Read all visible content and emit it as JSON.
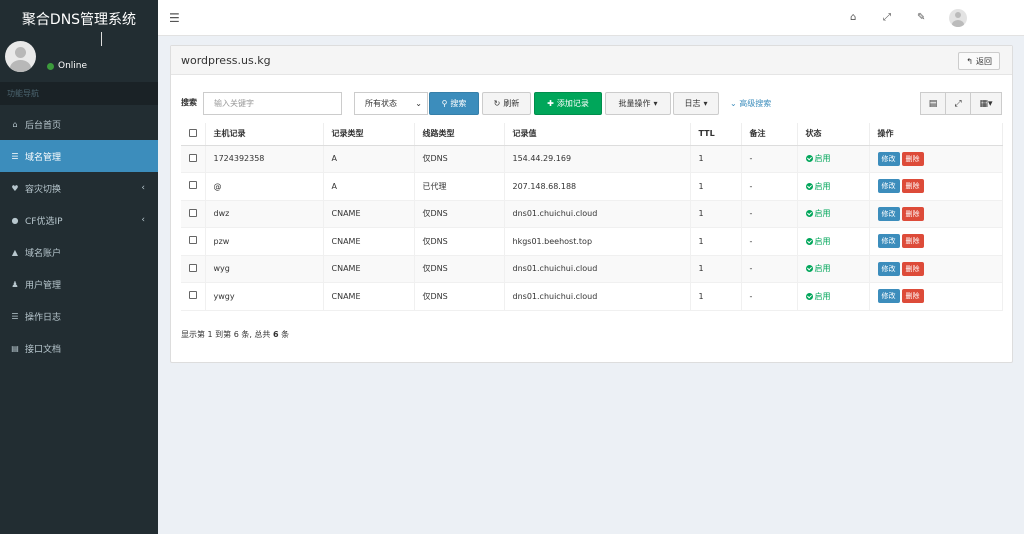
{
  "app": {
    "title": "聚合DNS管理系统"
  },
  "user": {
    "status": "Online"
  },
  "nav": {
    "header": "功能导航",
    "items": [
      {
        "label": "后台首页",
        "icon": "home-icon",
        "glyph": "⌂",
        "active": false,
        "caret": ""
      },
      {
        "label": "域名管理",
        "icon": "list-icon",
        "glyph": "☰",
        "active": true,
        "caret": ""
      },
      {
        "label": "容灾切换",
        "icon": "heartbeat-icon",
        "glyph": "♥",
        "active": false,
        "caret": "‹"
      },
      {
        "label": "CF优选IP",
        "icon": "globe-icon",
        "glyph": "●",
        "active": false,
        "caret": "‹"
      },
      {
        "label": "域名账户",
        "icon": "lock-icon",
        "glyph": "▲",
        "active": false,
        "caret": ""
      },
      {
        "label": "用户管理",
        "icon": "user-icon",
        "glyph": "♟",
        "active": false,
        "caret": ""
      },
      {
        "label": "操作日志",
        "icon": "log-icon",
        "glyph": "☰",
        "active": false,
        "caret": ""
      },
      {
        "label": "接口文档",
        "icon": "book-icon",
        "glyph": "▤",
        "active": false,
        "caret": ""
      }
    ]
  },
  "topbar": {
    "icons": [
      "home-icon",
      "fullscreen-icon",
      "wrench-icon"
    ]
  },
  "panel": {
    "title": "wordpress.us.kg",
    "back_label": "返回"
  },
  "toolbar": {
    "search_label": "搜索",
    "search_placeholder": "输入关键字",
    "status_select": "所有状态",
    "search_btn": "搜索",
    "refresh_btn": "刷新",
    "add_btn": "添加记录",
    "batch_btn": "批量操作",
    "log_btn": "日志",
    "advanced_link": "高级搜索"
  },
  "table": {
    "headers": [
      "主机记录",
      "记录类型",
      "线路类型",
      "记录值",
      "TTL",
      "备注",
      "状态",
      "操作"
    ],
    "rows": [
      {
        "host": "1724392358",
        "type": "A",
        "line": "仅DNS",
        "value": "154.44.29.169",
        "ttl": "1",
        "note": "-",
        "status": "启用"
      },
      {
        "host": "@",
        "type": "A",
        "line": "已代理",
        "value": "207.148.68.188",
        "ttl": "1",
        "note": "-",
        "status": "启用"
      },
      {
        "host": "dwz",
        "type": "CNAME",
        "line": "仅DNS",
        "value": "dns01.chuichui.cloud",
        "ttl": "1",
        "note": "-",
        "status": "启用"
      },
      {
        "host": "pzw",
        "type": "CNAME",
        "line": "仅DNS",
        "value": "hkgs01.beehost.top",
        "ttl": "1",
        "note": "-",
        "status": "启用"
      },
      {
        "host": "wyg",
        "type": "CNAME",
        "line": "仅DNS",
        "value": "dns01.chuichui.cloud",
        "ttl": "1",
        "note": "-",
        "status": "启用"
      },
      {
        "host": "ywgy",
        "type": "CNAME",
        "line": "仅DNS",
        "value": "dns01.chuichui.cloud",
        "ttl": "1",
        "note": "-",
        "status": "启用"
      }
    ],
    "edit_label": "修改",
    "delete_label": "删除"
  },
  "pagination": {
    "prefix": "显示第 1 到第 6 条, 总共 ",
    "total": "6",
    "suffix": " 条"
  },
  "colors": {
    "sidebar": "#222d32",
    "accent": "#3c8dbc",
    "success": "#00a65a",
    "danger": "#dd4b39"
  }
}
